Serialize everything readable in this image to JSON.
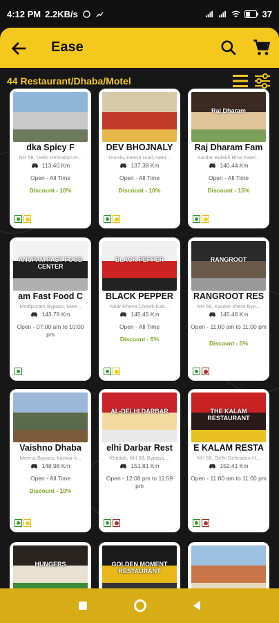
{
  "statusbar": {
    "time": "4:12 PM",
    "speed": "2.2KB/s",
    "battery": "37"
  },
  "appbar": {
    "title": "Ease"
  },
  "listing": {
    "count_label": "44 Restaurant/Dhaba/Motel"
  },
  "cards": [
    {
      "name": "dka Spicy F",
      "address": "NH 58, Delhi Dehradun H...",
      "distance": "113.40 Km",
      "hours": "Open - All Time",
      "discount": "Discount - 10%",
      "badges": [
        "veg",
        "egg"
      ],
      "photo_text": "",
      "photo_colors": [
        "#8fb6d6",
        "#c9c9c9",
        "#6a7a5a"
      ]
    },
    {
      "name": "DEV BHOJNALY",
      "address": "Dorala,meerut road,meer...",
      "distance": "137.38 Km",
      "hours": "Open - All Time",
      "discount": "Discount - 10%",
      "badges": [
        "veg",
        "egg"
      ],
      "photo_text": "",
      "photo_colors": [
        "#d8c9a8",
        "#c23a2a",
        "#e6b84a"
      ]
    },
    {
      "name": "Raj Dharam Fam",
      "address": "Sardar Balabh Bhai Patel...",
      "distance": "140.44 Km",
      "hours": "Open - All Time",
      "discount": "Discount - 15%",
      "badges": [
        "veg",
        "egg"
      ],
      "photo_text": "Raj Dharam",
      "photo_colors": [
        "#3a2a22",
        "#e0c59a",
        "#7aa05a"
      ]
    },
    {
      "name": "am Fast Food C",
      "address": "Modipuram Bypass, Mee...",
      "distance": "143.78 Km",
      "hours": "Open - 07:00 am to 10:00 pm",
      "discount": "",
      "badges": [
        "veg"
      ],
      "photo_text": "ANUPAM FAST FOOD CENTER",
      "photo_colors": [
        "#f2f2f2",
        "#222",
        "#b0b0b0"
      ]
    },
    {
      "name": "BLACK PEPPER",
      "address": "Near Kheva Chowk Kan...",
      "distance": "145.45 Km",
      "hours": "Open - All Time",
      "discount": "Discount - 5%",
      "badges": [
        "veg",
        "egg"
      ],
      "photo_text": "BLACK PEPPER",
      "photo_colors": [
        "#f0f0f0",
        "#c22",
        "#222"
      ]
    },
    {
      "name": "RANGROOT RES",
      "address": "NH 58, Kanker khera Byp...",
      "distance": "145.46 Km",
      "hours": "Open - 11:00 am to 11:00 pm",
      "discount": "Discount - 5%",
      "badges": [
        "veg",
        "nonveg"
      ],
      "photo_text": "RANGROOT",
      "photo_colors": [
        "#2a2a2a",
        "#6a5a4a",
        "#999"
      ]
    },
    {
      "name": "Vaishno Dhaba",
      "address": "Meerut Bypass, kankar k...",
      "distance": "148.98 Km",
      "hours": "Open - All Time",
      "discount": "Discount - 10%",
      "badges": [
        "veg",
        "egg"
      ],
      "photo_text": "",
      "photo_colors": [
        "#9bb8d8",
        "#5a6a4a",
        "#7a5a3a"
      ]
    },
    {
      "name": "elhi Darbar Rest",
      "address": "Khadoli, NH 58, Bypass,...",
      "distance": "151.81 Km",
      "hours": "Open - 12:08 pm to 11:59 pm",
      "discount": "",
      "badges": [
        "veg",
        "nonveg"
      ],
      "photo_text": "AL-DELHI DARBAR",
      "photo_colors": [
        "#c9242a",
        "#f2d9a0",
        "#e8e8e8"
      ]
    },
    {
      "name": "E KALAM RESTA",
      "address": "NH 58, Delhi Dehradun H...",
      "distance": "152.41 Km",
      "hours": "Open - 11:00 am to 11:00 pm",
      "discount": "",
      "badges": [
        "veg",
        "nonveg"
      ],
      "photo_text": "THE KALAM RESTAURANT",
      "photo_colors": [
        "#c92222",
        "#2a1a1a",
        "#e8c020"
      ]
    },
    {
      "name": "",
      "address": "",
      "distance": "",
      "hours": "",
      "discount": "",
      "badges": [],
      "photo_text": "HUNGERS",
      "photo_colors": [
        "#2a2420",
        "#e8e0d0",
        "#3a8a3a"
      ]
    },
    {
      "name": "",
      "address": "",
      "distance": "",
      "hours": "",
      "discount": "",
      "badges": [],
      "photo_text": "GOLDEN MOMENT RESTAURANT",
      "photo_colors": [
        "#1a1a1a",
        "#e8b818",
        "#333"
      ]
    },
    {
      "name": "",
      "address": "",
      "distance": "",
      "hours": "",
      "discount": "",
      "badges": [],
      "photo_text": "",
      "photo_colors": [
        "#9cc0e0",
        "#c9754a",
        "#e8d8c0"
      ]
    }
  ],
  "colors": {
    "accent": "#f4c81c",
    "discount": "#7aa11c",
    "nav": "#d7ad16"
  }
}
